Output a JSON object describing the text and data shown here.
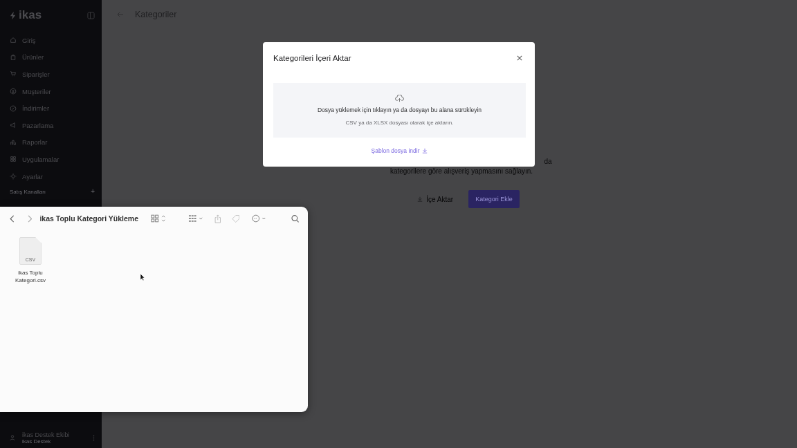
{
  "sidebar": {
    "logo": "ikas",
    "items": [
      {
        "label": "Giriş"
      },
      {
        "label": "Ürünler"
      },
      {
        "label": "Siparişler"
      },
      {
        "label": "Müşteriler"
      },
      {
        "label": "İndirimler"
      },
      {
        "label": "Pazarlama"
      },
      {
        "label": "Raporlar"
      },
      {
        "label": "Uygulamalar"
      },
      {
        "label": "Ayarlar"
      }
    ],
    "section": {
      "label": "Satış Kanalları",
      "action": "+"
    },
    "user": {
      "name": "ikas Destek Ekibi",
      "subtitle": "ikas Destek"
    }
  },
  "page": {
    "title": "Kategoriler",
    "empty_state": {
      "line_fragment": "da",
      "description": "kategorilere göre alışveriş yapmasını sağlayın.",
      "buttons": [
        {
          "label": "İçe Aktar",
          "kind": "secondary"
        },
        {
          "label": "Kategori Ekle",
          "kind": "primary"
        }
      ]
    }
  },
  "modal": {
    "title": "Kategorileri İçeri Aktar",
    "dropzone": {
      "text": "Dosya yüklemek için tıklayın ya da dosyayı bu alana sürükleyin",
      "hint": "CSV ya da XLSX dosyası olarak içe aktarın."
    },
    "template_link": "Şablon dosya indir"
  },
  "finder": {
    "title": "ikas Toplu Kategori Yükleme",
    "files": [
      {
        "name": "ikas Toplu Kategori.csv",
        "badge": "CSV"
      }
    ]
  }
}
